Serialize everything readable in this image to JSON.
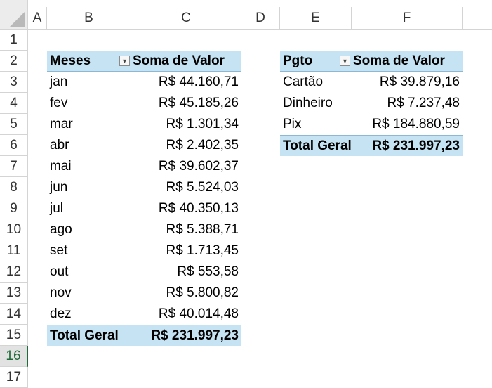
{
  "columns": [
    "A",
    "B",
    "C",
    "D",
    "E",
    "F"
  ],
  "rows": [
    "1",
    "2",
    "3",
    "4",
    "5",
    "6",
    "7",
    "8",
    "9",
    "10",
    "11",
    "12",
    "13",
    "14",
    "15",
    "16",
    "17"
  ],
  "active_row": "16",
  "pivot_meses": {
    "header": {
      "label": "Meses",
      "value": "Soma de Valor"
    },
    "items": [
      {
        "label": "jan",
        "value": "R$ 44.160,71"
      },
      {
        "label": "fev",
        "value": "R$ 45.185,26"
      },
      {
        "label": "mar",
        "value": "R$ 1.301,34"
      },
      {
        "label": "abr",
        "value": "R$ 2.402,35"
      },
      {
        "label": "mai",
        "value": "R$ 39.602,37"
      },
      {
        "label": "jun",
        "value": "R$ 5.524,03"
      },
      {
        "label": "jul",
        "value": "R$ 40.350,13"
      },
      {
        "label": "ago",
        "value": "R$ 5.388,71"
      },
      {
        "label": "set",
        "value": "R$ 1.713,45"
      },
      {
        "label": "out",
        "value": "R$ 553,58"
      },
      {
        "label": "nov",
        "value": "R$ 5.800,82"
      },
      {
        "label": "dez",
        "value": "R$ 40.014,48"
      }
    ],
    "total": {
      "label": "Total Geral",
      "value": "R$ 231.997,23"
    }
  },
  "pivot_pgto": {
    "header": {
      "label": "Pgto",
      "value": "Soma de Valor"
    },
    "items": [
      {
        "label": "Cartão",
        "value": "R$ 39.879,16"
      },
      {
        "label": "Dinheiro",
        "value": "R$ 7.237,48"
      },
      {
        "label": "Pix",
        "value": "R$ 184.880,59"
      }
    ],
    "total": {
      "label": "Total Geral",
      "value": "R$ 231.997,23"
    }
  },
  "colors": {
    "header_fill": "#c5e3f2",
    "active_row_accent": "#1e6b3a"
  }
}
